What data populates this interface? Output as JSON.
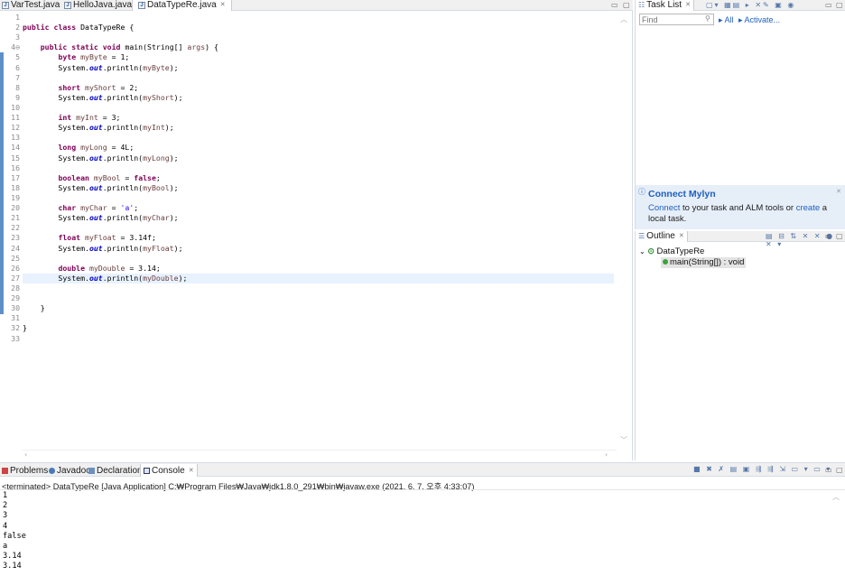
{
  "editor_tabs": [
    {
      "label": "VarTest.java",
      "active": false
    },
    {
      "label": "HelloJava.java",
      "active": false
    },
    {
      "label": "DataTypeRe.java",
      "active": true
    }
  ],
  "gutter": [
    "1",
    "2",
    "3",
    "4⊖",
    "5",
    "6",
    "7",
    "8",
    "9",
    "10",
    "11",
    "12",
    "13",
    "14",
    "15",
    "16",
    "17",
    "18",
    "19",
    "20",
    "21",
    "22",
    "23",
    "24",
    "25",
    "26",
    "27",
    "28",
    "29",
    "30",
    "31",
    "32",
    "33"
  ],
  "code_lines": [
    "",
    "public class DataTypeRe {",
    "",
    "    public static void main(String[] args) {",
    "        byte myByte = 1;",
    "        System.out.println(myByte);",
    "",
    "        short myShort = 2;",
    "        System.out.println(myShort);",
    "",
    "        int myInt = 3;",
    "        System.out.println(myInt);",
    "",
    "        long myLong = 4L;",
    "        System.out.println(myLong);",
    "",
    "        boolean myBool = false;",
    "        System.out.println(myBool);",
    "",
    "        char myChar = 'a';",
    "        System.out.println(myChar);",
    "",
    "        float myFloat = 3.14f;",
    "        System.out.println(myFloat);",
    "",
    "        double myDouble = 3.14;",
    "        System.out.println(myDouble);",
    "",
    "",
    "    }",
    "",
    "}",
    ""
  ],
  "current_line": 27,
  "task_list": {
    "tab_label": "Task List",
    "find_placeholder": "Find",
    "link_all": "All",
    "link_activate": "Activate..."
  },
  "mylyn": {
    "title": "Connect Mylyn",
    "connect_link": "Connect",
    "text_1": " to your task and ALM tools or ",
    "create_link": "create",
    "text_2": " a local task."
  },
  "outline": {
    "tab_label": "Outline",
    "class_name": "DataTypeRe",
    "method": "main(String[]) : void"
  },
  "bottom_tabs": [
    {
      "label": "Problems",
      "active": false
    },
    {
      "label": "Javadoc",
      "active": false
    },
    {
      "label": "Declaration",
      "active": false
    },
    {
      "label": "Console",
      "active": true
    }
  ],
  "console": {
    "status": "<terminated> DataTypeRe [Java Application] C:₩Program Files₩Java₩jdk1.8.0_291₩bin₩javaw.exe (2021. 6. 7. 오후 4:33:07)",
    "output": [
      "1",
      "2",
      "3",
      "4",
      "false",
      "a",
      "3.14",
      "3.14"
    ]
  },
  "colors": {
    "keyword": "#7f0055",
    "static_field": "#0000c0",
    "variable": "#6a3e3e",
    "char_literal": "#2a00ff",
    "link": "#1f5fbf",
    "change_marker": "#5e8fc9"
  }
}
